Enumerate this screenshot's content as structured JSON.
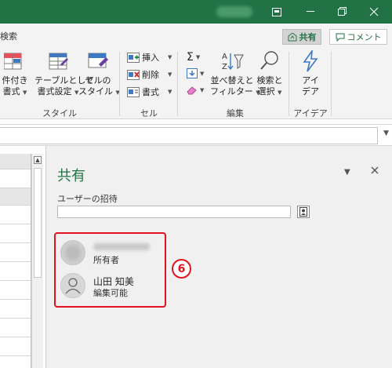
{
  "window": {
    "minimize_icon": "−",
    "restore_icon": "❐",
    "options_icon": "▣"
  },
  "tabs": {
    "search_label": "検索",
    "share_label": "共有",
    "comment_label": "コメント"
  },
  "ribbon": {
    "styles": {
      "conditional_label_1": "件付き",
      "conditional_label_2": "書式",
      "table_format_label_1": "テーブルとして",
      "table_format_label_2": "書式設定",
      "cell_style_label_1": "セルの",
      "cell_style_label_2": "スタイル",
      "group_label": "スタイル"
    },
    "cells": {
      "insert_label": "挿入",
      "delete_label": "削除",
      "format_label": "書式",
      "group_label": "セル"
    },
    "editing": {
      "sort_label_1": "並べ替えと",
      "sort_label_2": "フィルター",
      "find_label_1": "検索と",
      "find_label_2": "選択",
      "group_label": "編集"
    },
    "ideas": {
      "ideas_label_1": "アイ",
      "ideas_label_2": "デア",
      "group_label": "アイデア"
    }
  },
  "pane": {
    "title": "共有",
    "invite_label": "ユーザーの招待",
    "invite_value": "",
    "people": [
      {
        "name": "",
        "role": "所有者"
      },
      {
        "name": "山田 知美",
        "role": "編集可能"
      }
    ],
    "callout_number": "6"
  },
  "colors": {
    "excel_green": "#217346",
    "callout_red": "#e0141e"
  }
}
